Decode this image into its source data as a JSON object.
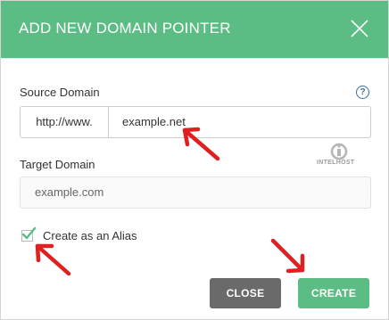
{
  "dialog": {
    "title": "ADD NEW DOMAIN POINTER"
  },
  "source_domain": {
    "label": "Source Domain",
    "prefix": "http://www.",
    "value": "example.net"
  },
  "target_domain": {
    "label": "Target Domain",
    "placeholder": "example.com"
  },
  "alias": {
    "label": "Create as an Alias",
    "checked": true
  },
  "buttons": {
    "close": "CLOSE",
    "create": "CREATE"
  },
  "watermark": {
    "text": "INTELHOST"
  },
  "colors": {
    "header": "#5cbd84",
    "create_button": "#5cbd84",
    "close_button": "#6a6a6a",
    "annotation_arrow": "#e02020",
    "help_icon": "#3a6ea5"
  }
}
